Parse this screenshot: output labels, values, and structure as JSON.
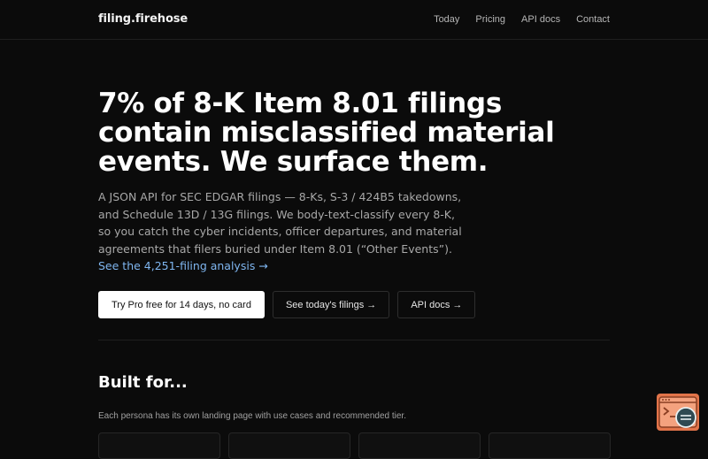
{
  "nav": {
    "brand_left": "filing",
    "brand_dot": ".",
    "brand_right": "firehose",
    "links": [
      "Today",
      "Pricing",
      "API docs",
      "Contact"
    ]
  },
  "hero": {
    "headline": "7% of 8-K Item 8.01 filings contain misclassified material events. We surface them.",
    "lead": "A JSON API for SEC EDGAR filings — 8-Ks, S-3 / 424B5 takedowns, and Schedule 13D / 13G filings. We body-text-classify every 8-K, so you catch the cyber incidents, officer departures, and material agreements that filers buried under Item 8.01 (“Other Events”). ",
    "lead_link": "See the 4,251-filing analysis →"
  },
  "cta": {
    "primary": "Try Pro free for 14 days, no card",
    "secondary": "See today's filings →",
    "tertiary": "API docs →"
  },
  "built_for": {
    "title": "Built for...",
    "subtitle": "Each persona has its own landing page with use cases and recommended tier."
  },
  "colors": {
    "background": "#0b0b0b",
    "link": "#7fb6f0",
    "widget": "#e1744a"
  },
  "icons": {
    "widget": "chat-support-icon"
  }
}
